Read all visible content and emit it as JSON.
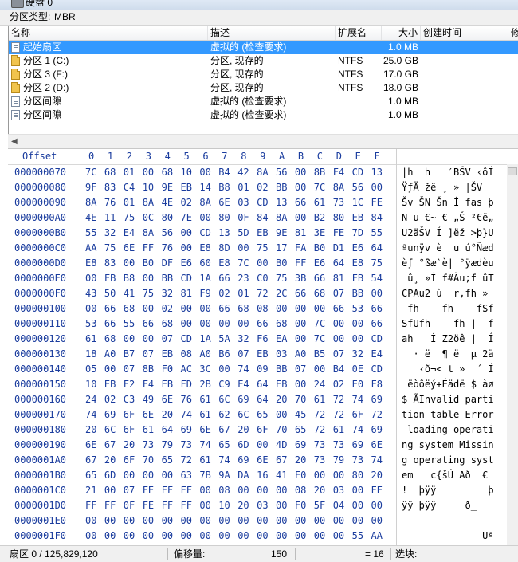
{
  "window": {
    "title": "硬盘 0"
  },
  "partition_type": {
    "label": "分区类型:",
    "value": "MBR"
  },
  "list": {
    "columns": [
      "名称",
      "描述",
      "扩展名",
      "大小",
      "创建时间",
      "修"
    ],
    "rows": [
      {
        "icon": "doc-icon",
        "name": "起始扇区",
        "desc": "虚拟的 (检查要求)",
        "ext": "",
        "size": "1.0 MB",
        "selected": true
      },
      {
        "icon": "folder-icon",
        "name": "分区 1 (C:)",
        "desc": "分区, 现存的",
        "ext": "NTFS",
        "size": "25.0 GB",
        "selected": false
      },
      {
        "icon": "folder-icon",
        "name": "分区 3 (F:)",
        "desc": "分区, 现存的",
        "ext": "NTFS",
        "size": "17.0 GB",
        "selected": false
      },
      {
        "icon": "folder-icon",
        "name": "分区 2 (D:)",
        "desc": "分区, 现存的",
        "ext": "NTFS",
        "size": "18.0 GB",
        "selected": false
      },
      {
        "icon": "doc-icon",
        "name": "分区间隙",
        "desc": "虚拟的 (检查要求)",
        "ext": "",
        "size": "1.0 MB",
        "selected": false
      },
      {
        "icon": "doc-icon",
        "name": "分区间隙",
        "desc": "虚拟的 (检查要求)",
        "ext": "",
        "size": "1.0 MB",
        "selected": false
      }
    ]
  },
  "hex": {
    "offset_label": "Offset",
    "columns": [
      "0",
      "1",
      "2",
      "3",
      "4",
      "5",
      "6",
      "7",
      "8",
      "9",
      "A",
      "B",
      "C",
      "D",
      "E",
      "F"
    ],
    "rows": [
      {
        "offset": "000000070",
        "bytes": [
          "7C",
          "68",
          "01",
          "00",
          "68",
          "10",
          "00",
          "B4",
          "42",
          "8A",
          "56",
          "00",
          "8B",
          "F4",
          "CD",
          "13"
        ],
        "ascii": "|h  h   ′BŠV ‹ôÍ"
      },
      {
        "offset": "000000080",
        "bytes": [
          "9F",
          "83",
          "C4",
          "10",
          "9E",
          "EB",
          "14",
          "B8",
          "01",
          "02",
          "BB",
          "00",
          "7C",
          "8A",
          "56",
          "00"
        ],
        "ascii": "ŸƒÄ žë ¸ » |ŠV "
      },
      {
        "offset": "000000090",
        "bytes": [
          "8A",
          "76",
          "01",
          "8A",
          "4E",
          "02",
          "8A",
          "6E",
          "03",
          "CD",
          "13",
          "66",
          "61",
          "73",
          "1C",
          "FE"
        ],
        "ascii": "Šv ŠN Šn Í fas þ"
      },
      {
        "offset": "0000000A0",
        "bytes": [
          "4E",
          "11",
          "75",
          "0C",
          "80",
          "7E",
          "00",
          "80",
          "0F",
          "84",
          "8A",
          "00",
          "B2",
          "80",
          "EB",
          "84"
        ],
        "ascii": "N u €~ € „Š ²€ë„"
      },
      {
        "offset": "0000000B0",
        "bytes": [
          "55",
          "32",
          "E4",
          "8A",
          "56",
          "00",
          "CD",
          "13",
          "5D",
          "EB",
          "9E",
          "81",
          "3E",
          "FE",
          "7D",
          "55"
        ],
        "ascii": "U2äŠV Í ]ëž >þ}U"
      },
      {
        "offset": "0000000C0",
        "bytes": [
          "AA",
          "75",
          "6E",
          "FF",
          "76",
          "00",
          "E8",
          "8D",
          "00",
          "75",
          "17",
          "FA",
          "B0",
          "D1",
          "E6",
          "64"
        ],
        "ascii": "ªunÿv è  u ú°Ñæd"
      },
      {
        "offset": "0000000D0",
        "bytes": [
          "E8",
          "83",
          "00",
          "B0",
          "DF",
          "E6",
          "60",
          "E8",
          "7C",
          "00",
          "B0",
          "FF",
          "E6",
          "64",
          "E8",
          "75"
        ],
        "ascii": "èƒ °ßæ`è| °ÿædèu"
      },
      {
        "offset": "0000000E0",
        "bytes": [
          "00",
          "FB",
          "B8",
          "00",
          "BB",
          "CD",
          "1A",
          "66",
          "23",
          "C0",
          "75",
          "3B",
          "66",
          "81",
          "FB",
          "54"
        ],
        "ascii": " û¸ »Í f#Àu;f ûT"
      },
      {
        "offset": "0000000F0",
        "bytes": [
          "43",
          "50",
          "41",
          "75",
          "32",
          "81",
          "F9",
          "02",
          "01",
          "72",
          "2C",
          "66",
          "68",
          "07",
          "BB",
          "00"
        ],
        "ascii": "CPAu2 ù  r,fh » "
      },
      {
        "offset": "000000100",
        "bytes": [
          "00",
          "66",
          "68",
          "00",
          "02",
          "00",
          "00",
          "66",
          "68",
          "08",
          "00",
          "00",
          "00",
          "66",
          "53",
          "66"
        ],
        "ascii": " fh    fh    fSf"
      },
      {
        "offset": "000000110",
        "bytes": [
          "53",
          "66",
          "55",
          "66",
          "68",
          "00",
          "00",
          "00",
          "00",
          "66",
          "68",
          "00",
          "7C",
          "00",
          "00",
          "66"
        ],
        "ascii": "SfUfh    fh |  f"
      },
      {
        "offset": "000000120",
        "bytes": [
          "61",
          "68",
          "00",
          "00",
          "07",
          "CD",
          "1A",
          "5A",
          "32",
          "F6",
          "EA",
          "00",
          "7C",
          "00",
          "00",
          "CD"
        ],
        "ascii": "ah   Í Z2öê |  Í"
      },
      {
        "offset": "000000130",
        "bytes": [
          "18",
          "A0",
          "B7",
          "07",
          "EB",
          "08",
          "A0",
          "B6",
          "07",
          "EB",
          "03",
          "A0",
          "B5",
          "07",
          "32",
          "E4"
        ],
        "ascii": "  · ë  ¶ ë  µ 2ä"
      },
      {
        "offset": "000000140",
        "bytes": [
          "05",
          "00",
          "07",
          "8B",
          "F0",
          "AC",
          "3C",
          "00",
          "74",
          "09",
          "BB",
          "07",
          "00",
          "B4",
          "0E",
          "CD"
        ],
        "ascii": "   ‹ð¬< t »  ´ Í"
      },
      {
        "offset": "000000150",
        "bytes": [
          "10",
          "EB",
          "F2",
          "F4",
          "EB",
          "FD",
          "2B",
          "C9",
          "E4",
          "64",
          "EB",
          "00",
          "24",
          "02",
          "E0",
          "F8"
        ],
        "ascii": " ëòôëý+Éädë $ àø"
      },
      {
        "offset": "000000160",
        "bytes": [
          "24",
          "02",
          "C3",
          "49",
          "6E",
          "76",
          "61",
          "6C",
          "69",
          "64",
          "20",
          "70",
          "61",
          "72",
          "74",
          "69"
        ],
        "ascii": "$ ÃInvalid parti"
      },
      {
        "offset": "000000170",
        "bytes": [
          "74",
          "69",
          "6F",
          "6E",
          "20",
          "74",
          "61",
          "62",
          "6C",
          "65",
          "00",
          "45",
          "72",
          "72",
          "6F",
          "72"
        ],
        "ascii": "tion table Error"
      },
      {
        "offset": "000000180",
        "bytes": [
          "20",
          "6C",
          "6F",
          "61",
          "64",
          "69",
          "6E",
          "67",
          "20",
          "6F",
          "70",
          "65",
          "72",
          "61",
          "74",
          "69"
        ],
        "ascii": " loading operati"
      },
      {
        "offset": "000000190",
        "bytes": [
          "6E",
          "67",
          "20",
          "73",
          "79",
          "73",
          "74",
          "65",
          "6D",
          "00",
          "4D",
          "69",
          "73",
          "73",
          "69",
          "6E"
        ],
        "ascii": "ng system Missin"
      },
      {
        "offset": "0000001A0",
        "bytes": [
          "67",
          "20",
          "6F",
          "70",
          "65",
          "72",
          "61",
          "74",
          "69",
          "6E",
          "67",
          "20",
          "73",
          "79",
          "73",
          "74"
        ],
        "ascii": "g operating syst"
      },
      {
        "offset": "0000001B0",
        "bytes": [
          "65",
          "6D",
          "00",
          "00",
          "00",
          "63",
          "7B",
          "9A",
          "DA",
          "16",
          "41",
          "F0",
          "00",
          "00",
          "80",
          "20"
        ],
        "ascii": "em   c{šÚ Að  € "
      },
      {
        "offset": "0000001C0",
        "bytes": [
          "21",
          "00",
          "07",
          "FE",
          "FF",
          "FF",
          "00",
          "08",
          "00",
          "00",
          "00",
          "08",
          "20",
          "03",
          "00",
          "FE"
        ],
        "ascii": "!  þÿÿ         þ"
      },
      {
        "offset": "0000001D0",
        "bytes": [
          "FF",
          "FF",
          "0F",
          "FE",
          "FF",
          "FF",
          "00",
          "10",
          "20",
          "03",
          "00",
          "F0",
          "5F",
          "04",
          "00",
          "00"
        ],
        "ascii": "ÿÿ þÿÿ     ð_   "
      },
      {
        "offset": "0000001E0",
        "bytes": [
          "00",
          "00",
          "00",
          "00",
          "00",
          "00",
          "00",
          "00",
          "00",
          "00",
          "00",
          "00",
          "00",
          "00",
          "00",
          "00"
        ],
        "ascii": "                "
      },
      {
        "offset": "0000001F0",
        "bytes": [
          "00",
          "00",
          "00",
          "00",
          "00",
          "00",
          "00",
          "00",
          "00",
          "00",
          "00",
          "00",
          "00",
          "00",
          "55",
          "AA"
        ],
        "ascii": "              Uª"
      }
    ]
  },
  "status": {
    "sector": "扇区 0 / 125,829,120",
    "offset_label": "偏移量:",
    "offset_value": "150",
    "eq_value": "= 16",
    "selection_label": "选块:"
  }
}
